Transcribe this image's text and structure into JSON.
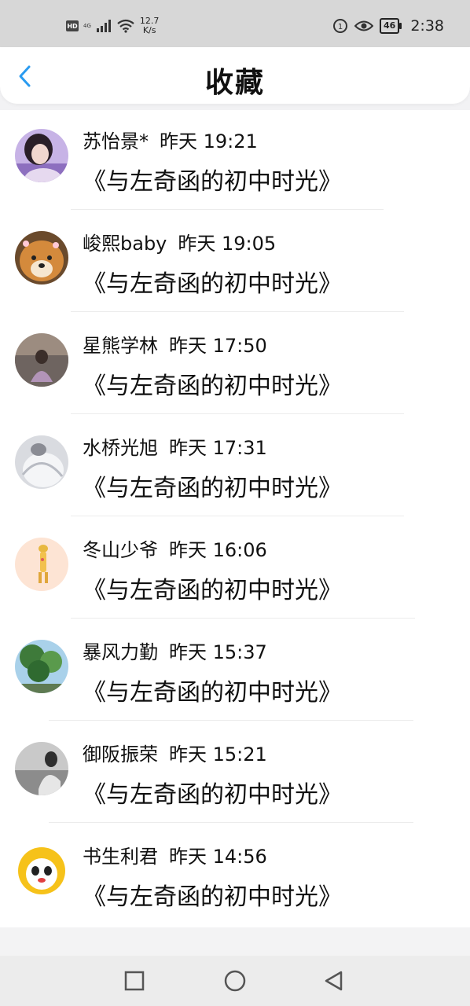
{
  "status_bar": {
    "hd": "HD",
    "network": "4G",
    "speed_value": "12.7",
    "speed_unit": "K/s",
    "battery": "46",
    "time": "2:38"
  },
  "header": {
    "title": "收藏"
  },
  "favorites": [
    {
      "name": "苏怡景*",
      "time": "昨天 19:21",
      "book": "《与左奇函的初中时光》"
    },
    {
      "name": "峻熙baby",
      "time": "昨天 19:05",
      "book": "《与左奇函的初中时光》"
    },
    {
      "name": "星熊学林",
      "time": "昨天 17:50",
      "book": "《与左奇函的初中时光》"
    },
    {
      "name": "水桥光旭",
      "time": "昨天 17:31",
      "book": "《与左奇函的初中时光》"
    },
    {
      "name": "冬山少爷",
      "time": "昨天 16:06",
      "book": "《与左奇函的初中时光》"
    },
    {
      "name": "暴风力勤",
      "time": "昨天 15:37",
      "book": "《与左奇函的初中时光》"
    },
    {
      "name": "御阪振荣",
      "time": "昨天 15:21",
      "book": "《与左奇函的初中时光》"
    },
    {
      "name": "书生利君",
      "time": "昨天 14:56",
      "book": "《与左奇函的初中时光》"
    }
  ],
  "colors": {
    "accent": "#2a9bf0",
    "background": "#ffffff",
    "status_bar": "#d7d7d7"
  },
  "icons": [
    "back-arrow-icon",
    "square-recents-icon",
    "circle-home-icon",
    "triangle-back-icon"
  ]
}
